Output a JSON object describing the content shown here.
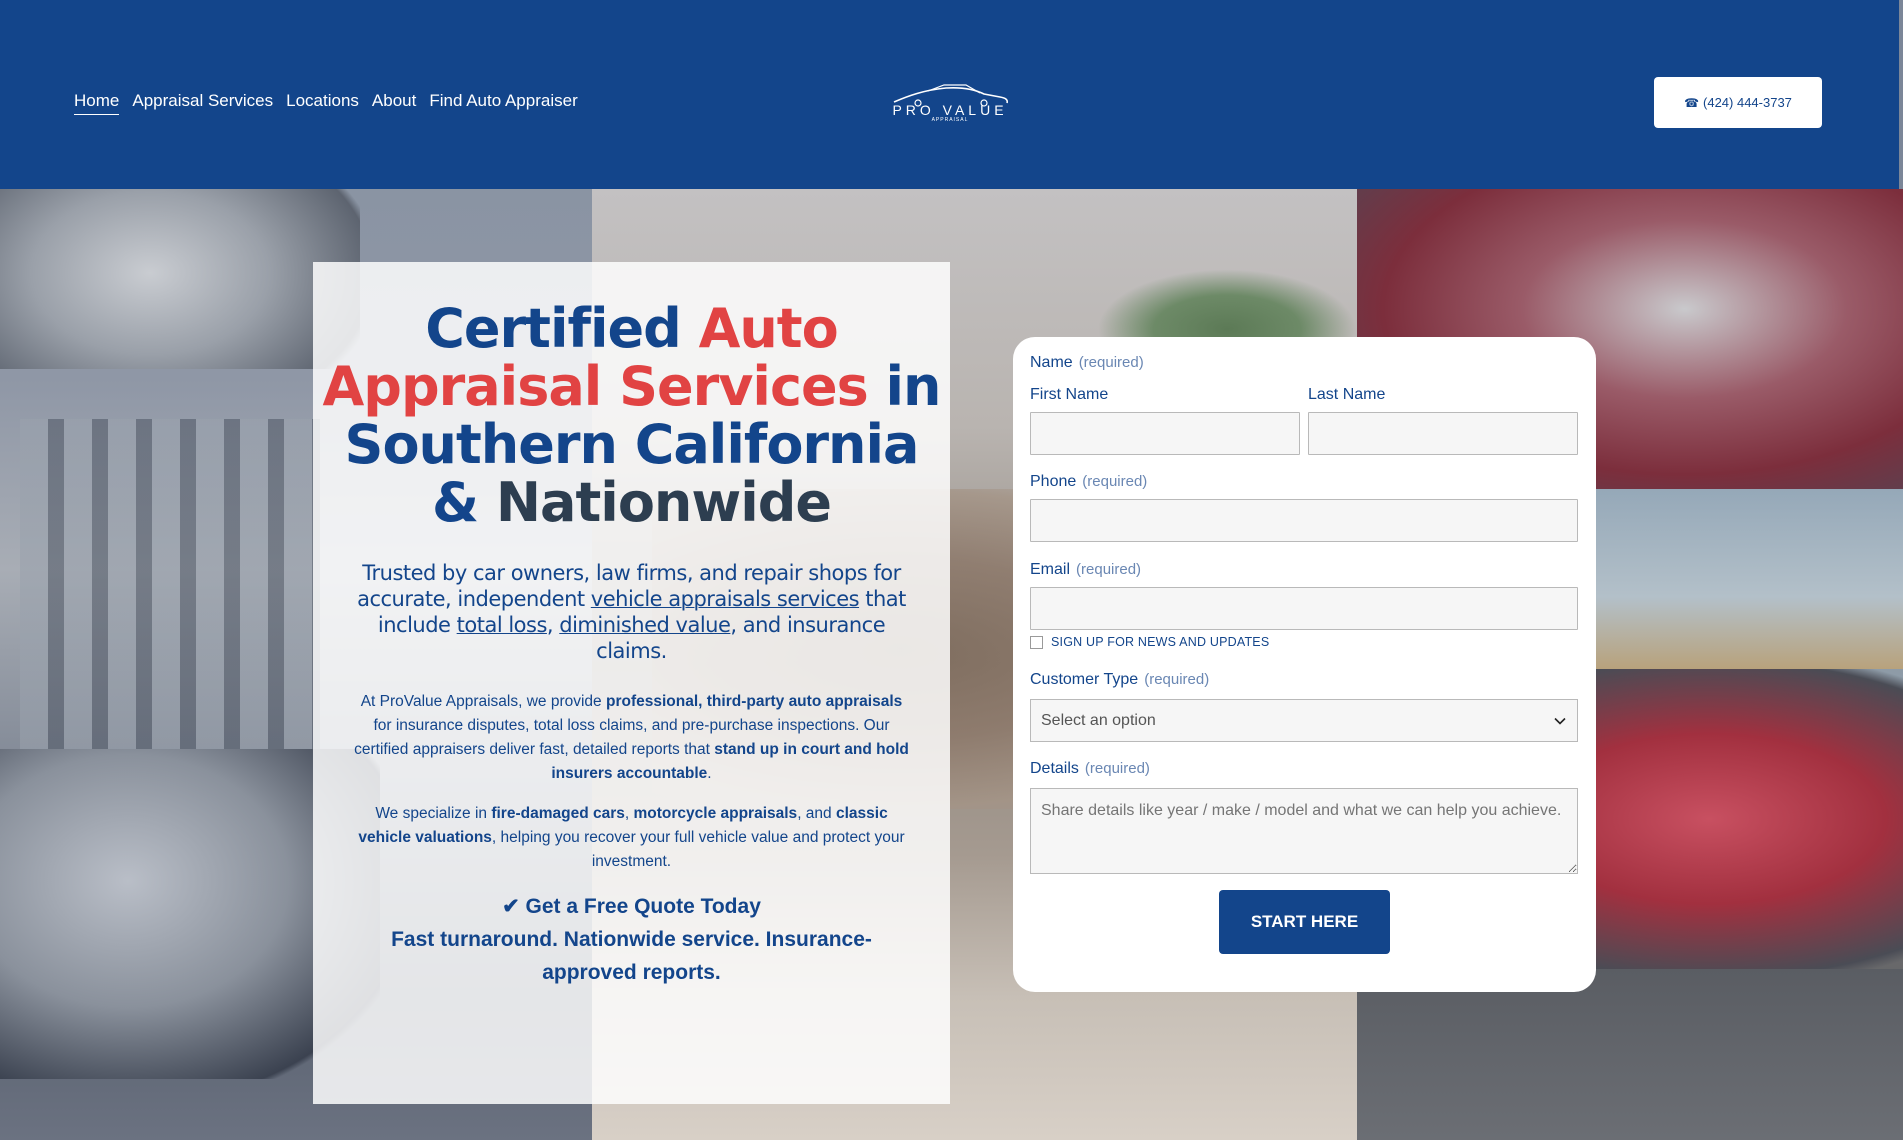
{
  "nav": {
    "items": [
      {
        "label": "Home",
        "active": true
      },
      {
        "label": "Appraisal Services"
      },
      {
        "label": "Locations"
      },
      {
        "label": "About"
      },
      {
        "label": "Find Auto Appraiser"
      }
    ]
  },
  "logo": {
    "name": "PRO VALUE",
    "sub": "APPRAISAL"
  },
  "header": {
    "phone_icon": "☎",
    "phone": "(424) 444-3737"
  },
  "hero": {
    "title": {
      "part1": "Certified ",
      "highlight": "Auto Appraisal Services",
      "part2": " in Southern California & ",
      "part3": "Nationwide"
    },
    "subtitle": {
      "t1": "Trusted by car owners, law firms, and repair shops for accurate, independent ",
      "link1": "vehicle appraisals services",
      "t2": " that include ",
      "link2": "total loss",
      "t3": ", ",
      "link3": "diminished value",
      "t4": ", and insurance claims."
    },
    "p1": {
      "t1": "At ProValue Appraisals, we provide ",
      "b1": "professional, third-party auto appraisals",
      "t2": " for insurance disputes, total loss claims, and pre-purchase inspections. Our certified appraisers deliver fast, detailed reports that ",
      "b2": "stand up in court and hold insurers accountable",
      "t3": "."
    },
    "p2": {
      "t1": "We specialize in ",
      "b1": "fire-damaged cars",
      "t2": ", ",
      "b2": "motorcycle appraisals",
      "t3": ", and ",
      "b3": "classic vehicle valuations",
      "t4": ", helping you recover your full vehicle value and protect your investment."
    },
    "cta_line1": "✔ Get a Free Quote Today",
    "cta_line2": "Fast turnaround. Nationwide service. Insurance-approved reports."
  },
  "form": {
    "name_label": "Name",
    "required": "(required)",
    "first_name_label": "First Name",
    "last_name_label": "Last Name",
    "first_name_value": "",
    "last_name_value": "",
    "phone_label": "Phone",
    "phone_value": "",
    "email_label": "Email",
    "email_value": "",
    "newsletter_label": "SIGN UP FOR NEWS AND UPDATES",
    "customer_type_label": "Customer Type",
    "customer_type_selected": "Select an option",
    "details_label": "Details",
    "details_placeholder": "Share details like year / make / model and what we can help you achieve.",
    "submit_label": "START HERE"
  },
  "colors": {
    "brand": "#13458b",
    "accent": "#e14343"
  }
}
